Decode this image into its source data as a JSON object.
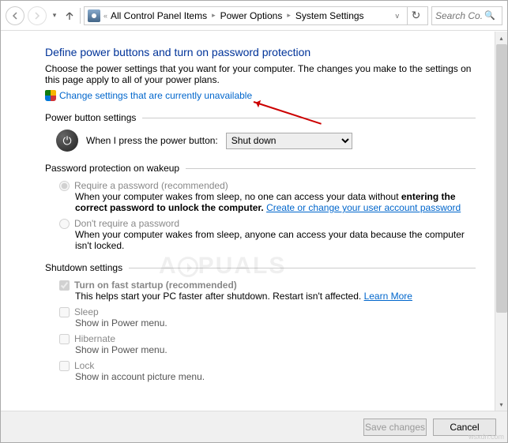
{
  "nav": {
    "address_segments": [
      "All Control Panel Items",
      "Power Options",
      "System Settings"
    ],
    "search_placeholder": "Search Co..."
  },
  "page": {
    "title": "Define power buttons and turn on password protection",
    "description": "Choose the power settings that you want for your computer. The changes you make to the settings on this page apply to all of your power plans.",
    "change_link": "Change settings that are currently unavailable"
  },
  "power_button": {
    "section_title": "Power button settings",
    "label": "When I press the power button:",
    "selected": "Shut down",
    "options": [
      "Shut down"
    ]
  },
  "password": {
    "section_title": "Password protection on wakeup",
    "opt1_label": "Require a password (recommended)",
    "opt1_desc_a": "When your computer wakes from sleep, no one can access your data without ",
    "opt1_desc_b": "entering the correct password to unlock the computer. ",
    "opt1_link": "Create or change your user account password",
    "opt2_label": "Don't require a password",
    "opt2_desc": "When your computer wakes from sleep, anyone can access your data because the computer isn't locked."
  },
  "shutdown": {
    "section_title": "Shutdown settings",
    "fast_label": "Turn on fast startup (recommended)",
    "fast_desc": "This helps start your PC faster after shutdown. Restart isn't affected. ",
    "learn_more": "Learn More",
    "sleep_label": "Sleep",
    "sleep_desc": "Show in Power menu.",
    "hibernate_label": "Hibernate",
    "hibernate_desc": "Show in Power menu.",
    "lock_label": "Lock",
    "lock_desc": "Show in account picture menu."
  },
  "buttons": {
    "save": "Save changes",
    "cancel": "Cancel"
  },
  "watermark": "A  PUALS",
  "source": "wsxdn.com"
}
